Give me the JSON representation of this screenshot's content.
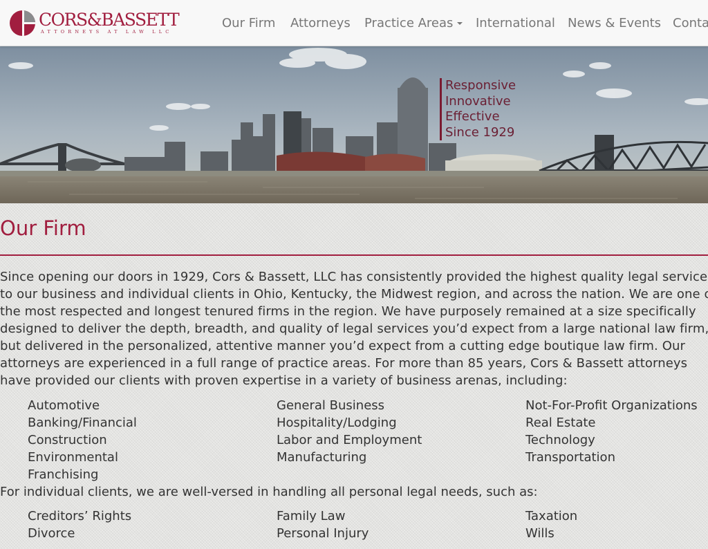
{
  "brand": {
    "name": "CORS&BASSETT",
    "tagline": "ATTORNEYS AT LAW LLC"
  },
  "nav": {
    "items": [
      {
        "label": "Our Firm"
      },
      {
        "label": "Attorneys"
      },
      {
        "label": "Practice Areas"
      },
      {
        "label": "International"
      },
      {
        "label": "News & Events"
      },
      {
        "label": "Conta"
      }
    ]
  },
  "hero": {
    "lines": [
      "Responsive",
      "Innovative",
      "Effective",
      "Since 1929"
    ]
  },
  "page": {
    "title": "Our Firm",
    "intro": "Since opening our doors in 1929, Cors & Bassett, LLC has consistently provided the highest quality legal services to our business and individual clients in Ohio, Kentucky, the Midwest region, and across the nation. We are one of the most respected and longest tenured firms in the region. We have purposely remained at a size specifically designed to deliver the depth, breadth, and quality of legal services you’d expect from a large national law firm, but delivered in the personalized, attentive manner you’d expect from a cutting edge boutique law firm. Our attorneys are experienced in a full range of practice areas. For more than 85 years, Cors & Bassett attorneys have provided our clients with proven expertise in a variety of business arenas, including:",
    "business_areas": [
      [
        "Automotive",
        "Banking/Financial",
        "Construction",
        "Environmental",
        "Franchising"
      ],
      [
        "General Business",
        "Hospitality/Lodging",
        "Labor and Employment",
        "Manufacturing"
      ],
      [
        "Not-For-Profit Organizations",
        "Real Estate",
        "Technology",
        "Transportation"
      ]
    ],
    "individual_lead": "For individual clients, we are well-versed in handling all personal legal needs, such as:",
    "individual_areas": [
      [
        "Creditors’ Rights",
        "Divorce"
      ],
      [
        "Family Law",
        "Personal Injury"
      ],
      [
        "Taxation",
        "Wills"
      ]
    ]
  },
  "colors": {
    "brand": "#a11e3f",
    "nav_text": "#777777",
    "body_text": "#333333"
  }
}
